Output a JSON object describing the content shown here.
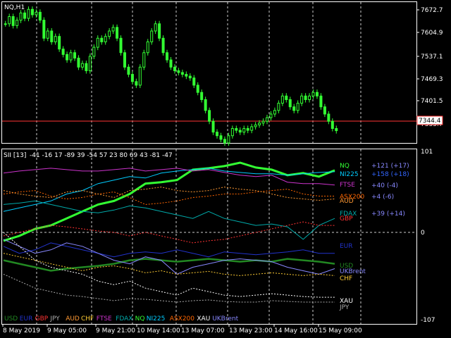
{
  "window": {
    "symbol_title": "NQ,H1",
    "indicator_title": "SII [13]",
    "indicator_values": "-41 -16 17 -89 39 -54 57 23 80 69 43 -81 -47"
  },
  "price_axis": {
    "labels": [
      "7672.7",
      "7604.9",
      "7537.1",
      "7469.3",
      "7401.5",
      "7333.7"
    ],
    "current_price": "7344.4"
  },
  "indicator_axis": {
    "labels": [
      "101",
      "0",
      "-107"
    ]
  },
  "time_axis": {
    "labels": [
      "8 May 2019",
      "9 May 05:00",
      "9 May 21:00",
      "10 May 14:00",
      "13 May 07:00",
      "13 May 23:00",
      "14 May 16:00",
      "15 May 09:00"
    ]
  },
  "right_labels": [
    {
      "name": "NQ",
      "value": "+121 (+17)",
      "color": "#33ff33"
    },
    {
      "name": "NI225",
      "value": "+158 (+18)",
      "color": "#00ccff"
    },
    {
      "name": "FTSE",
      "value": "+40 (-4)",
      "color": "#cc33cc"
    },
    {
      "name": "ASX200",
      "value": "+4 (-6)",
      "color": "#ff6600"
    },
    {
      "name": "AUD",
      "value": "",
      "color": "#ff9933"
    },
    {
      "name": "FDAX",
      "value": "+39 (+14)",
      "color": "#00aaaa"
    },
    {
      "name": "GBP",
      "value": "",
      "color": "#ff3333"
    },
    {
      "name": "EUR",
      "value": "",
      "color": "#2233cc"
    },
    {
      "name": "USD",
      "value": "",
      "color": "#228822"
    },
    {
      "name": "UKBrent",
      "value": "",
      "color": "#8888ff"
    },
    {
      "name": "CHF",
      "value": "",
      "color": "#ffcc33"
    },
    {
      "name": "XAU",
      "value": "",
      "color": "#ffffff"
    },
    {
      "name": "JPY",
      "value": "",
      "color": "#aaaaaa"
    }
  ],
  "legend": [
    {
      "name": "USD",
      "color": "#228822"
    },
    {
      "name": "EUR",
      "color": "#2233cc"
    },
    {
      "name": "GBP",
      "color": "#ff3333"
    },
    {
      "name": "JPY",
      "color": "#aaaaaa"
    },
    {
      "name": "AUD",
      "color": "#ff9933"
    },
    {
      "name": "CHF",
      "color": "#ffcc33"
    },
    {
      "name": "FTSE",
      "color": "#cc33cc"
    },
    {
      "name": "FDAX",
      "color": "#00aaaa"
    },
    {
      "name": "NQ",
      "color": "#33ff33"
    },
    {
      "name": "NI225",
      "color": "#00ccff"
    },
    {
      "name": "ASX200",
      "color": "#ff6600"
    },
    {
      "name": "XAU",
      "color": "#ffffff"
    },
    {
      "name": "UKBrent",
      "color": "#8888ff"
    }
  ],
  "colors": {
    "background": "#000000",
    "grid": "#ffffff",
    "candle": "#33ff33",
    "price_line": "#ff3333"
  },
  "chart_data": [
    {
      "type": "candlestick",
      "title": "NQ,H1",
      "ylim": [
        7310,
        7700
      ],
      "close_series": [
        7640,
        7660,
        7635,
        7650,
        7670,
        7655,
        7680,
        7665,
        7672,
        7650,
        7600,
        7620,
        7590,
        7605,
        7570,
        7555,
        7540,
        7560,
        7545,
        7520,
        7530,
        7510,
        7550,
        7575,
        7600,
        7590,
        7605,
        7620,
        7630,
        7600,
        7560,
        7520,
        7500,
        7480,
        7470,
        7520,
        7560,
        7590,
        7620,
        7640,
        7600,
        7560,
        7540,
        7520,
        7510,
        7505,
        7500,
        7495,
        7490,
        7470,
        7450,
        7430,
        7400,
        7370,
        7340,
        7330,
        7320,
        7310,
        7330,
        7350,
        7345,
        7340,
        7350,
        7345,
        7355,
        7360,
        7365,
        7370,
        7380,
        7390,
        7400,
        7420,
        7440,
        7430,
        7410,
        7400,
        7420,
        7440,
        7430,
        7440,
        7450,
        7440,
        7410,
        7390,
        7370,
        7350,
        7344
      ]
    },
    {
      "type": "line",
      "title": "SII [13]",
      "ylim": [
        -107,
        101
      ],
      "series": [
        {
          "name": "NQ",
          "values": [
            -12,
            -5,
            5,
            10,
            20,
            30,
            40,
            45,
            55,
            70,
            72,
            75,
            90,
            92,
            95,
            100,
            93,
            90,
            82,
            85,
            80,
            89
          ]
        },
        {
          "name": "NI225",
          "values": [
            30,
            35,
            40,
            45,
            55,
            60,
            70,
            75,
            80,
            78,
            85,
            88,
            90,
            92,
            88,
            86,
            84,
            84,
            82,
            84,
            86,
            87
          ]
        },
        {
          "name": "FTSE",
          "values": [
            85,
            88,
            90,
            92,
            90,
            88,
            88,
            90,
            92,
            88,
            90,
            92,
            88,
            90,
            86,
            82,
            80,
            82,
            72,
            70,
            70,
            68
          ]
        },
        {
          "name": "ASX200",
          "values": [
            55,
            58,
            60,
            52,
            48,
            50,
            55,
            58,
            50,
            40,
            42,
            45,
            50,
            52,
            55,
            55,
            58,
            60,
            62,
            55,
            52,
            52
          ]
        },
        {
          "name": "AUD",
          "values": [
            60,
            55,
            52,
            50,
            58,
            60,
            55,
            50,
            60,
            62,
            65,
            60,
            58,
            60,
            65,
            62,
            60,
            55,
            50,
            48,
            46,
            48
          ]
        },
        {
          "name": "FDAX",
          "values": [
            40,
            42,
            45,
            40,
            35,
            30,
            28,
            32,
            38,
            35,
            30,
            25,
            20,
            30,
            20,
            15,
            10,
            12,
            8,
            -10,
            10,
            20
          ]
        },
        {
          "name": "GBP",
          "values": [
            -5,
            0,
            5,
            10,
            8,
            5,
            2,
            0,
            -5,
            0,
            -5,
            -10,
            -15,
            -12,
            -10,
            -5,
            0,
            5,
            10,
            15,
            10,
            10
          ]
        },
        {
          "name": "EUR",
          "values": [
            -20,
            -30,
            -25,
            -15,
            -20,
            -25,
            -30,
            -35,
            -30,
            -28,
            -30,
            -25,
            -30,
            -35,
            -28,
            -30,
            -32,
            -30,
            -28,
            -25,
            -30,
            -30
          ]
        },
        {
          "name": "USD",
          "values": [
            -40,
            -45,
            -50,
            -55,
            -52,
            -50,
            -48,
            -45,
            -40,
            -38,
            -40,
            -42,
            -40,
            -38,
            -40,
            -42,
            -40,
            -42,
            -38,
            -40,
            -42,
            -45
          ]
        },
        {
          "name": "UKBrent",
          "values": [
            -10,
            -20,
            -30,
            -25,
            -15,
            -20,
            -30,
            -40,
            -45,
            -35,
            -40,
            -60,
            -50,
            -45,
            -40,
            -38,
            -40,
            -42,
            -50,
            -55,
            -60,
            -52
          ]
        },
        {
          "name": "CHF",
          "values": [
            -30,
            -35,
            -40,
            -45,
            -50,
            -55,
            -50,
            -48,
            -52,
            -58,
            -55,
            -60,
            -58,
            -56,
            -60,
            -62,
            -60,
            -58,
            -60,
            -62,
            -60,
            -62
          ]
        },
        {
          "name": "XAU",
          "values": [
            0,
            -20,
            -40,
            -50,
            -55,
            -60,
            -70,
            -75,
            -70,
            -80,
            -85,
            -90,
            -80,
            -85,
            -90,
            -92,
            -90,
            -88,
            -90,
            -92,
            -93,
            -93
          ]
        },
        {
          "name": "JPY",
          "values": [
            -60,
            -70,
            -80,
            -85,
            -90,
            -92,
            -95,
            -98,
            -95,
            -96,
            -98,
            -100,
            -98,
            -97,
            -99,
            -100,
            -100,
            -98,
            -99,
            -100,
            -100,
            -100
          ]
        }
      ]
    }
  ]
}
